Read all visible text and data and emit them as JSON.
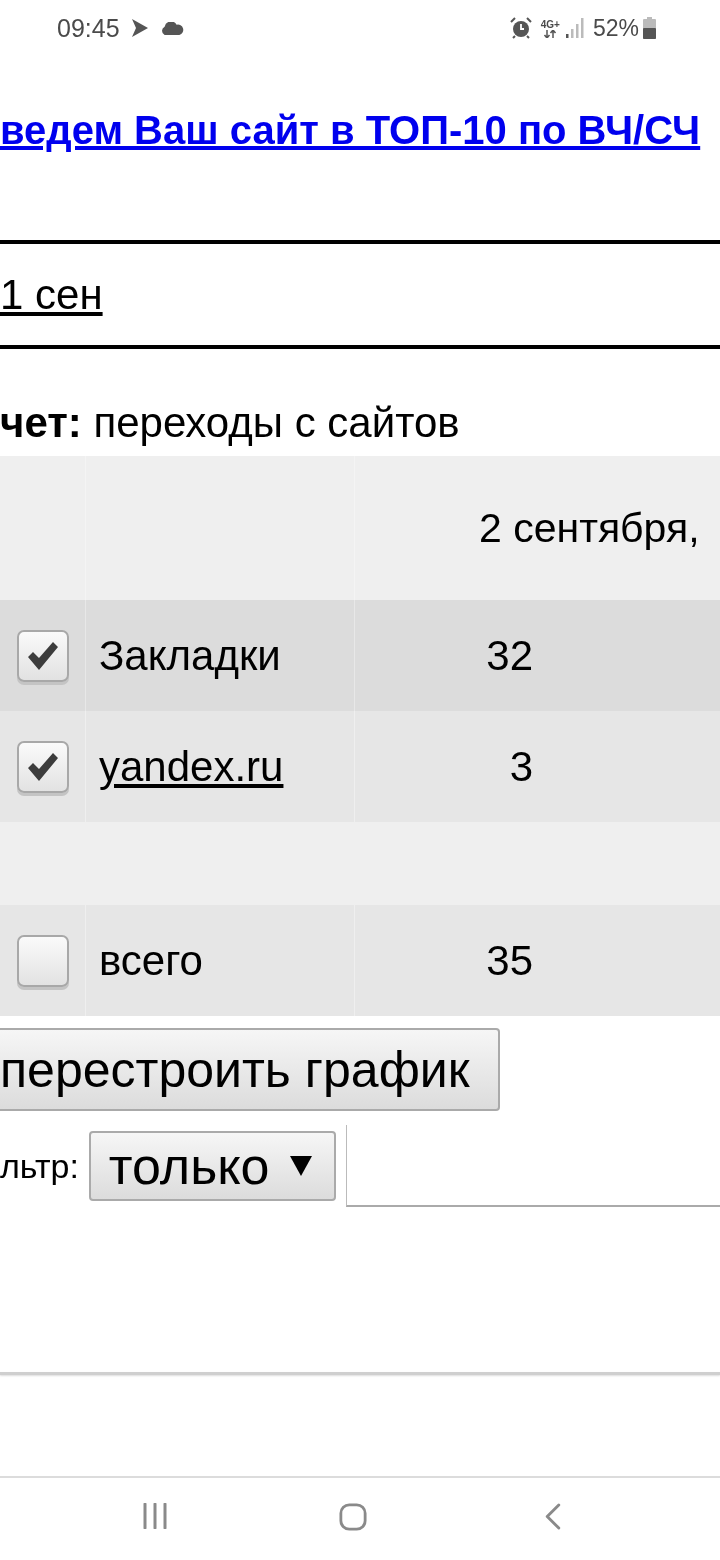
{
  "status_bar": {
    "time": "09:45",
    "network": "4G+",
    "battery": "52%"
  },
  "ad_link": "ведем Ваш сайт в ТОП-10 по ВЧ/СЧ",
  "period_link": "1 сен",
  "report": "**чет:** переходы с сайтов",
  "table": {
    "columns": [
      "2 сентября,"
    ],
    "rows": [
      {
        "kind": "item",
        "checked": true,
        "label": "Закладки",
        "link": false,
        "value": "32"
      },
      {
        "kind": "item",
        "checked": true,
        "label": "yandex.ru",
        "link": true,
        "value": "3"
      },
      {
        "kind": "spacer"
      },
      {
        "kind": "item",
        "checked": false,
        "label": "всего",
        "link": false,
        "value": "35"
      }
    ]
  },
  "rebuild_button": "перестроить график",
  "filter": {
    "label": "льтр:",
    "select": "только"
  }
}
